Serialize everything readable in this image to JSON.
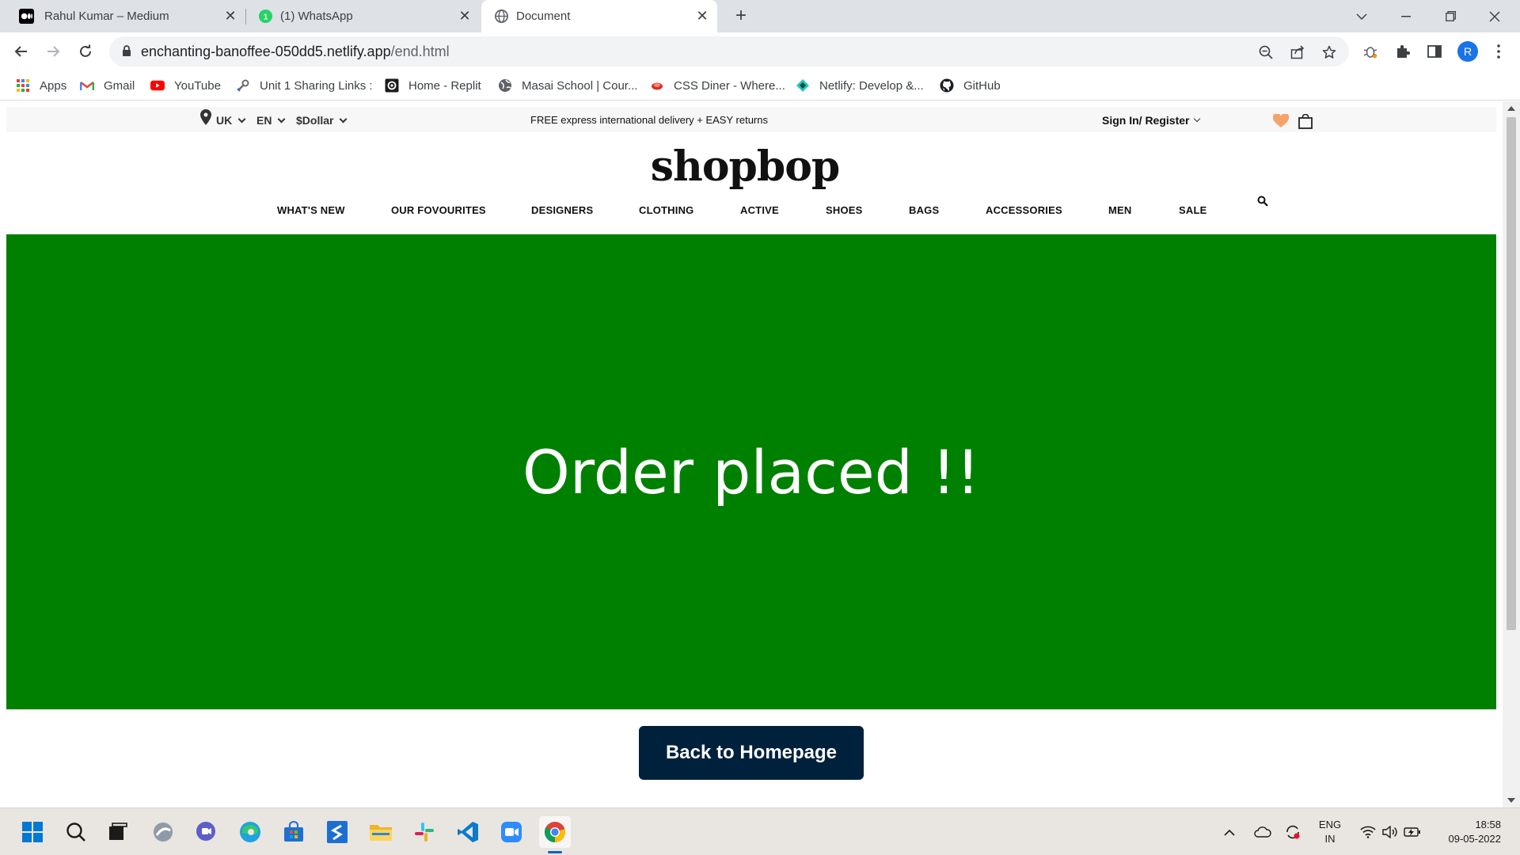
{
  "browser": {
    "tabs": [
      {
        "title": "Rahul Kumar – Medium",
        "icon": "medium-icon",
        "active": false
      },
      {
        "title": "(1) WhatsApp",
        "icon": "whatsapp-icon",
        "active": false
      },
      {
        "title": "Document",
        "icon": "globe-icon",
        "active": true
      }
    ],
    "close_glyph": "✕",
    "new_tab_glyph": "+",
    "url_host": "enchanting-banoffee-050dd5.netlify.app",
    "url_path": "/end.html",
    "profile_initial": "R"
  },
  "bookmarks": [
    {
      "label": "Apps",
      "icon": "apps-grid-icon"
    },
    {
      "label": "Gmail",
      "icon": "gmail-icon"
    },
    {
      "label": "YouTube",
      "icon": "youtube-icon"
    },
    {
      "label": "Unit 1 Sharing Links :",
      "icon": "wrench-icon"
    },
    {
      "label": "Home - Replit",
      "icon": "replit-icon"
    },
    {
      "label": "Masai School | Cour...",
      "icon": "globe-icon"
    },
    {
      "label": "CSS Diner - Where...",
      "icon": "css-diner-icon"
    },
    {
      "label": "Netlify: Develop &...",
      "icon": "netlify-icon"
    },
    {
      "label": "GitHub",
      "icon": "github-icon"
    }
  ],
  "site": {
    "topbar": {
      "country": "UK",
      "language": "EN",
      "currency": "$Dollar",
      "promo": "FREE express international delivery + EASY returns",
      "signin": "Sign In/ Register"
    },
    "logo": "shopbop",
    "nav": [
      "WHAT'S NEW",
      "OUR FOVOURITES",
      "DESIGNERS",
      "CLOTHING",
      "ACTIVE",
      "SHOES",
      "BAGS",
      "ACCESSORIES",
      "MEN",
      "SALE"
    ],
    "banner_text": "Order placed !!",
    "banner_color": "#008000",
    "home_button": "Back to Homepage",
    "button_color": "#00213c"
  },
  "taskbar": {
    "language_line1": "ENG",
    "language_line2": "IN",
    "time": "18:58",
    "date": "09-05-2022"
  }
}
